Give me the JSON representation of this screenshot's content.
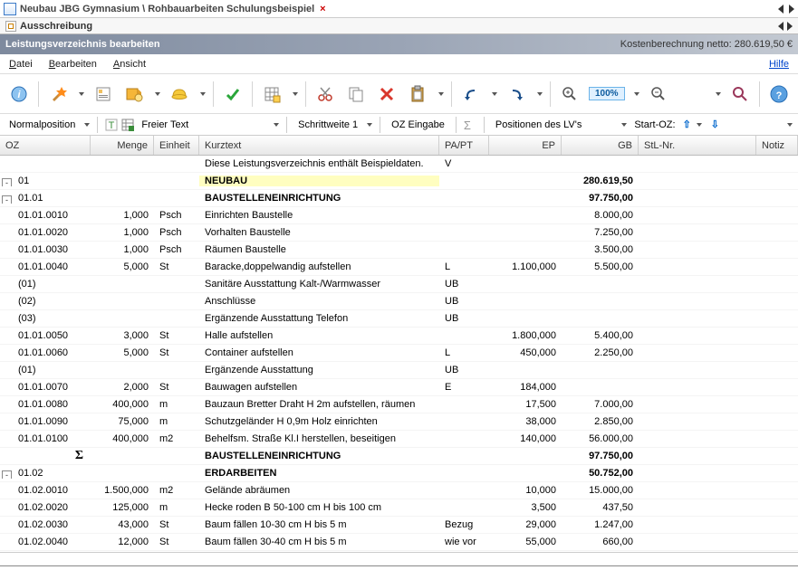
{
  "title": {
    "tab": "Neubau JBG Gymnasium \\ Rohbauarbeiten Schulungsbeispiel"
  },
  "subtab": {
    "label": "Ausschreibung"
  },
  "headerbar": {
    "title": "Leistungsverzeichnis bearbeiten",
    "right": "Kostenberechnung netto:  280.619,50 €"
  },
  "menu": {
    "datei": "Datei",
    "bearbeiten": "Bearbeiten",
    "ansicht": "Ansicht",
    "hilfe": "Hilfe"
  },
  "toolbar2": {
    "pos_type": "Normalposition",
    "freier_text": "Freier Text",
    "schritt": "Schrittweite 1",
    "oz_eingabe": "OZ Eingabe",
    "posdeslvs": "Positionen des LV's",
    "startoz": "Start-OZ:"
  },
  "zoom": {
    "text": "100%"
  },
  "columns": {
    "oz": "OZ",
    "menge": "Menge",
    "einheit": "Einheit",
    "kurztext": "Kurztext",
    "papt": "PA/PT",
    "ep": "EP",
    "gb": "GB",
    "stl": "StL-Nr.",
    "notiz": "Notiz"
  },
  "rows": [
    {
      "oz": "",
      "kt": "Diese Leistungsverzeichnis enthält Beispieldaten.",
      "pa": "V"
    },
    {
      "exp": "-",
      "oz": "01",
      "kt": "NEUBAU",
      "gb": "280.619,50",
      "bold": true,
      "hl": true
    },
    {
      "exp": "-",
      "oz": "01.01",
      "kt": "BAUSTELLENEINRICHTUNG",
      "gb": "97.750,00",
      "bold": true
    },
    {
      "oz": "01.01.0010",
      "mg": "1,000",
      "un": "Psch",
      "kt": "Einrichten Baustelle",
      "gb": "8.000,00"
    },
    {
      "oz": "01.01.0020",
      "mg": "1,000",
      "un": "Psch",
      "kt": "Vorhalten Baustelle",
      "gb": "7.250,00"
    },
    {
      "oz": "01.01.0030",
      "mg": "1,000",
      "un": "Psch",
      "kt": "Räumen Baustelle",
      "gb": "3.500,00"
    },
    {
      "oz": "01.01.0040",
      "mg": "5,000",
      "un": "St",
      "kt": "Baracke,doppelwandig aufstellen",
      "pa": "L",
      "ep": "1.100,000",
      "gb": "5.500,00"
    },
    {
      "oz": "(01)",
      "kt": "Sanitäre Ausstattung Kalt-/Warmwasser",
      "pa": "UB"
    },
    {
      "oz": "(02)",
      "kt": "Anschlüsse",
      "pa": "UB"
    },
    {
      "oz": "(03)",
      "kt": "Ergänzende Ausstattung Telefon",
      "pa": "UB"
    },
    {
      "oz": "01.01.0050",
      "mg": "3,000",
      "un": "St",
      "kt": "Halle aufstellen",
      "ep": "1.800,000",
      "gb": "5.400,00"
    },
    {
      "oz": "01.01.0060",
      "mg": "5,000",
      "un": "St",
      "kt": "Container aufstellen",
      "pa": "L",
      "ep": "450,000",
      "gb": "2.250,00"
    },
    {
      "oz": "(01)",
      "kt": "Ergänzende Ausstattung",
      "pa": "UB"
    },
    {
      "oz": "01.01.0070",
      "mg": "2,000",
      "un": "St",
      "kt": "Bauwagen aufstellen",
      "pa": "E",
      "ep": "184,000"
    },
    {
      "oz": "01.01.0080",
      "mg": "400,000",
      "un": "m",
      "kt": "Bauzaun Bretter Draht H 2m aufstellen, räumen",
      "ep": "17,500",
      "gb": "7.000,00"
    },
    {
      "oz": "01.01.0090",
      "mg": "75,000",
      "un": "m",
      "kt": "Schutzgeländer H 0,9m Holz einrichten",
      "ep": "38,000",
      "gb": "2.850,00"
    },
    {
      "oz": "01.01.0100",
      "mg": "400,000",
      "un": "m2",
      "kt": "Behelfsm. Straße Kl.I herstellen, beseitigen",
      "ep": "140,000",
      "gb": "56.000,00"
    },
    {
      "sigma": true,
      "kt": "BAUSTELLENEINRICHTUNG",
      "gb": "97.750,00",
      "bold": true
    },
    {
      "exp": "-",
      "oz": "01.02",
      "kt": "ERDARBEITEN",
      "gb": "50.752,00",
      "bold": true
    },
    {
      "oz": "01.02.0010",
      "mg": "1.500,000",
      "un": "m2",
      "kt": "Gelände abräumen",
      "ep": "10,000",
      "gb": "15.000,00"
    },
    {
      "oz": "01.02.0020",
      "mg": "125,000",
      "un": "m",
      "kt": "Hecke roden B 50-100 cm H bis 100 cm",
      "ep": "3,500",
      "gb": "437,50"
    },
    {
      "oz": "01.02.0030",
      "mg": "43,000",
      "un": "St",
      "kt": "Baum fällen 10-30 cm H bis 5 m",
      "pa": "Bezug",
      "ep": "29,000",
      "gb": "1.247,00"
    },
    {
      "oz": "01.02.0040",
      "mg": "12,000",
      "un": "St",
      "kt": "Baum fällen 30-40 cm H bis 5 m",
      "pa": "wie vor",
      "ep": "55,000",
      "gb": "660,00"
    }
  ]
}
